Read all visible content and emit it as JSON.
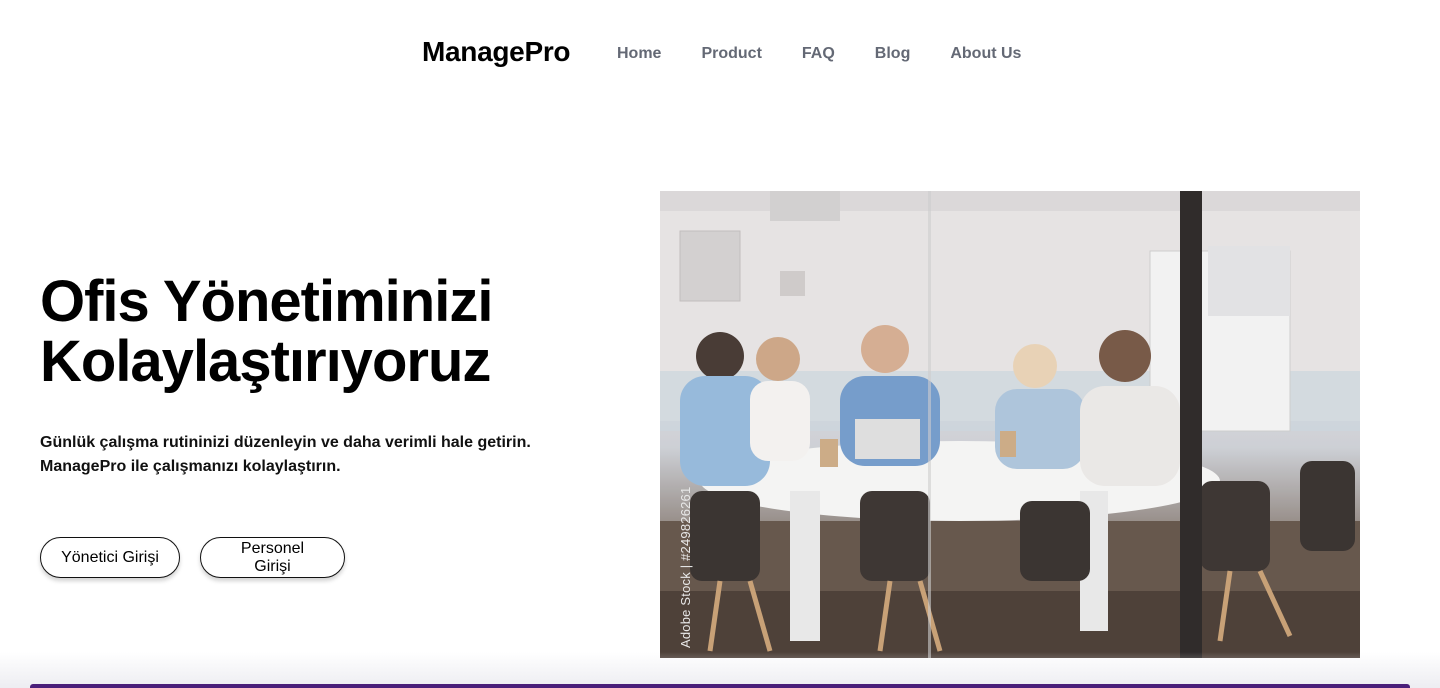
{
  "brand": "ManagePro",
  "nav": {
    "items": [
      "Home",
      "Product",
      "FAQ",
      "Blog",
      "About Us"
    ]
  },
  "hero": {
    "title_line1": "Ofis Yönetiminizi",
    "title_line2": "Kolaylaştırıyoruz",
    "text_line1": "Günlük çalışma rutininizi düzenleyin ve daha verimli hale getirin.",
    "text_line2": "ManagePro ile çalışmanızı kolaylaştırın.",
    "admin_button": "Yönetici Girişi",
    "staff_button": "Personel Girişi"
  },
  "photo": {
    "watermark": "Adobe Stock | #249826261"
  }
}
